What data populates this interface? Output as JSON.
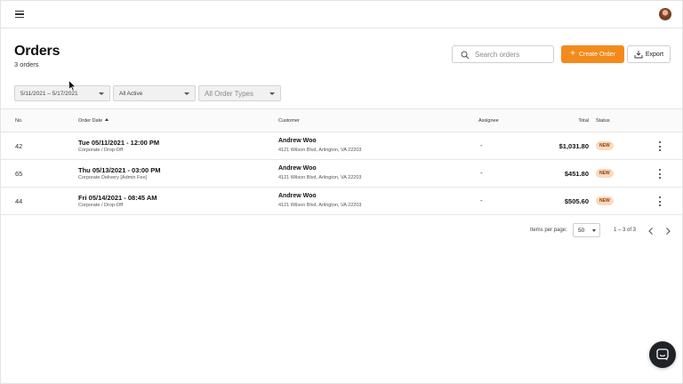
{
  "header": {
    "menu_icon": "hamburger-icon",
    "avatar_icon": "user-avatar"
  },
  "page": {
    "title": "Orders",
    "count_text": "3 orders"
  },
  "actions": {
    "search_placeholder": "Search orders",
    "create_label": "Create Order",
    "export_label": "Export",
    "accent_color": "#f28b1c"
  },
  "filters": {
    "date_range": "5/11/2021 – 5/17/2021",
    "status": "All Active",
    "order_types": "All Order Types"
  },
  "table": {
    "columns": {
      "no": "No.",
      "order_date": "Order Date",
      "customer": "Customer",
      "assignee": "Assignee",
      "total": "Total",
      "status": "Status"
    },
    "rows": [
      {
        "no": "42",
        "date": "Tue 05/11/2021  -  12:00 PM",
        "type": "Corporate / Drop-Off",
        "customer": "Andrew Woo",
        "address": "4121 Wilson Blvd, Arlington, VA 22203",
        "assignee": "-",
        "total": "$1,031.80",
        "status": "NEW"
      },
      {
        "no": "65",
        "date": "Thu 05/13/2021  -  03:00 PM",
        "type": "Corporate Delivery [Admin Fee]",
        "customer": "Andrew Woo",
        "address": "4121 Wilson Blvd, Arlington, VA 22203",
        "assignee": "-",
        "total": "$451.80",
        "status": "NEW"
      },
      {
        "no": "44",
        "date": "Fri 05/14/2021  -  08:45 AM",
        "type": "Corporate / Drop-Off",
        "customer": "Andrew Woo",
        "address": "4121 Wilson Blvd, Arlington, VA 22203",
        "assignee": "-",
        "total": "$505.60",
        "status": "NEW"
      }
    ],
    "status_badge_color": "#fcd9bd"
  },
  "pagination": {
    "items_per_page_label": "Items per page:",
    "items_per_page_value": "50",
    "range_text": "1 – 3 of 3"
  }
}
